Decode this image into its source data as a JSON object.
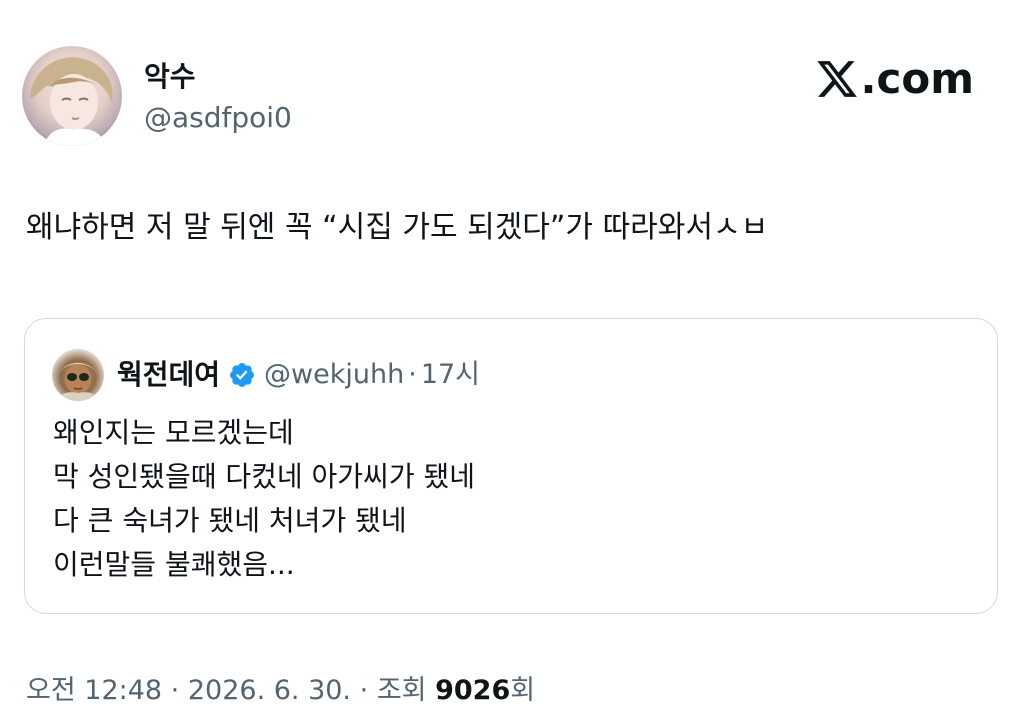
{
  "author": {
    "display_name": "악수",
    "handle": "@asdfpoi0"
  },
  "brand": {
    "label": ".com",
    "icon": "x-logo-icon"
  },
  "tweet": {
    "text": "왜냐하면 저 말 뒤엔 꼭 “시집 가도 되겠다”가 따라와서ㅅㅂ"
  },
  "quoted_tweet": {
    "display_name": "웍전데여",
    "verified_icon": "verified-badge-icon",
    "handle": "@wekjuhh",
    "separator": "·",
    "time": "17시",
    "lines": [
      "왜인지는 모르겠는데",
      "막 성인됐을때 다컸네 아가씨가 됐네",
      "다 큰 숙녀가 됐네 처녀가 됐네",
      "이런말들 불쾌했음..."
    ]
  },
  "meta": {
    "time": "오전 12:48",
    "separator": "·",
    "date": "2026. 6. 30.",
    "views_label": "조회",
    "views_count": "9026",
    "views_suffix": "회"
  },
  "colors": {
    "text": "#0f1419",
    "secondary": "#536471",
    "border": "#cfd9de",
    "verified": "#1d9bf0"
  }
}
